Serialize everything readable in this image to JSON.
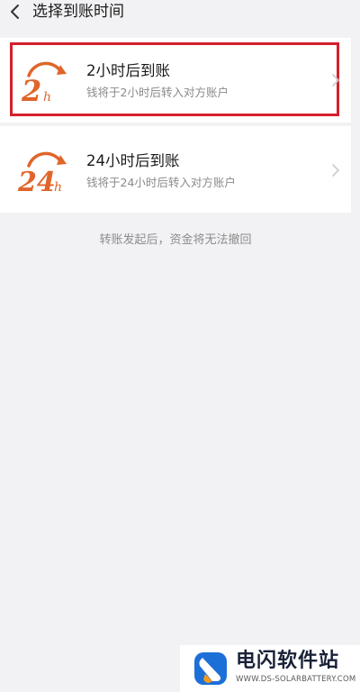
{
  "header": {
    "title": "选择到账时间",
    "back_icon": "chevron-left-icon"
  },
  "options": [
    {
      "logo_text": "2",
      "logo_unit": "h",
      "title": "2小时后到账",
      "subtitle": "钱将于2小时后转入对方账户",
      "highlighted": true
    },
    {
      "logo_text": "24",
      "logo_unit": "h",
      "title": "24小时后到账",
      "subtitle": "钱将于24小时后转入对方账户",
      "highlighted": false
    }
  ],
  "notice": "转账发起后，资金将无法撤回",
  "watermark": {
    "name": "电闪软件站",
    "url": "WWW.DS-SOLARBATTERY.COM"
  },
  "colors": {
    "background": "#f2f2f4",
    "card": "#ffffff",
    "highlight_border": "#d4202c",
    "logo_orange": "#e0652a",
    "title_text": "#1a1a1a",
    "subtitle_text": "#8a8a8a",
    "watermark_blue": "#1d6fd8",
    "watermark_orange": "#f39a1e"
  }
}
